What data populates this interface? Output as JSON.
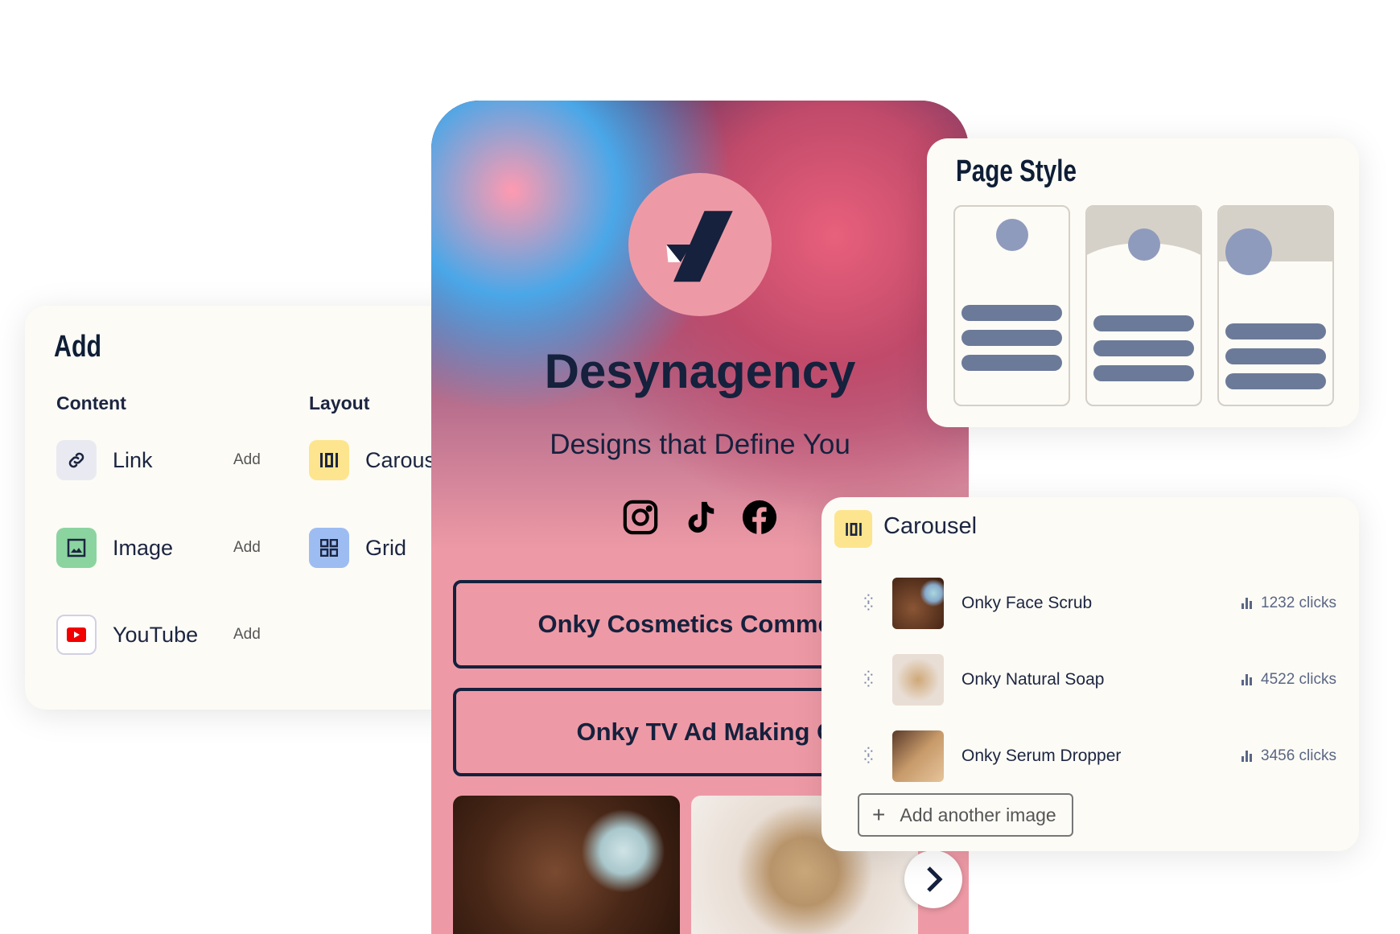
{
  "add_panel": {
    "title": "Add",
    "content_heading": "Content",
    "layout_heading": "Layout",
    "content_items": [
      {
        "label": "Link",
        "action": "Add",
        "icon": "link-icon"
      },
      {
        "label": "Image",
        "action": "Add",
        "icon": "image-icon"
      },
      {
        "label": "YouTube",
        "action": "Add",
        "icon": "youtube-icon"
      }
    ],
    "layout_items": [
      {
        "label": "Carousel",
        "icon": "carousel-icon"
      },
      {
        "label": "Grid",
        "icon": "grid-icon"
      }
    ]
  },
  "profile": {
    "name": "Desynagency",
    "tagline": "Designs that Define You",
    "socials": [
      "instagram-icon",
      "tiktok-icon",
      "facebook-icon"
    ],
    "links": [
      "Onky Cosmetics Commercial",
      "Onky TV Ad Making Of"
    ]
  },
  "page_style": {
    "title": "Page Style"
  },
  "carousel": {
    "title": "Carousel",
    "items": [
      {
        "name": "Onky Face Scrub",
        "clicks": "1232 clicks"
      },
      {
        "name": "Onky Natural Soap",
        "clicks": "4522 clicks"
      },
      {
        "name": "Onky Serum Dropper",
        "clicks": "3456 clicks"
      }
    ],
    "add_label": "Add another image"
  },
  "colors": {
    "accent_pink": "#ee9aa6",
    "navy": "#15213d",
    "yellow": "#fde58f",
    "green": "#8bd4a0",
    "blue": "#9dbcf2"
  }
}
